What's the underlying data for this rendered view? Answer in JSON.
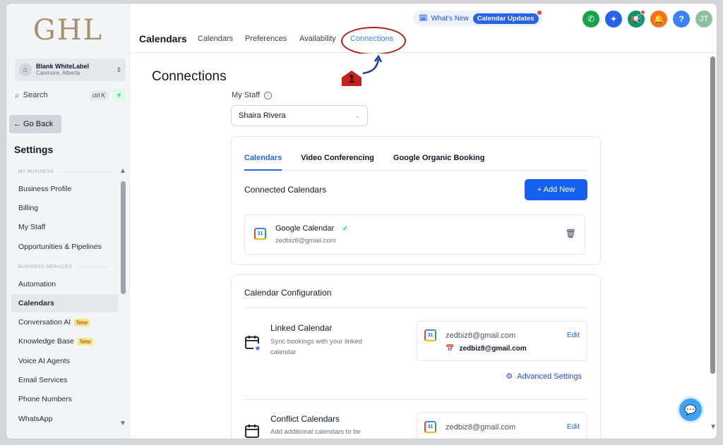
{
  "brand": {
    "logo": "GHL"
  },
  "account": {
    "name": "Blank WhiteLabel",
    "location": "Canmore, Alberta"
  },
  "search": {
    "label": "Search",
    "shortcut": "ctrl K"
  },
  "sidebar": {
    "go_back": "← Go Back",
    "settings_title": "Settings",
    "sections": {
      "my_business": "MY BUSINESS",
      "business_services": "BUSINESS SERVICES"
    },
    "items": [
      {
        "label": "Business Profile"
      },
      {
        "label": "Billing"
      },
      {
        "label": "My Staff"
      },
      {
        "label": "Opportunities & Pipelines"
      },
      {
        "label": "Automation"
      },
      {
        "label": "Calendars"
      },
      {
        "label": "Conversation AI",
        "badge": "New"
      },
      {
        "label": "Knowledge Base",
        "badge": "New"
      },
      {
        "label": "Voice AI Agents"
      },
      {
        "label": "Email Services"
      },
      {
        "label": "Phone Numbers"
      },
      {
        "label": "WhatsApp"
      }
    ]
  },
  "header": {
    "title": "Calendars",
    "tabs": [
      {
        "label": "Calendars"
      },
      {
        "label": "Preferences"
      },
      {
        "label": "Availability"
      },
      {
        "label": "Connections"
      }
    ],
    "whats_new": "What's New",
    "calendar_updates": "Calendar Updates",
    "avatar_initials": "JT",
    "help": "?"
  },
  "annotation": {
    "marker_number": "1"
  },
  "page": {
    "title": "Connections",
    "my_staff_label": "My Staff",
    "staff_selected": "Shaira Rivera"
  },
  "connected_card": {
    "tabs": [
      {
        "label": "Calendars"
      },
      {
        "label": "Video Conferencing"
      },
      {
        "label": "Google Organic Booking"
      }
    ],
    "section_title": "Connected Calendars",
    "add_new": "+ Add New",
    "calendar": {
      "name": "Google Calendar",
      "email": "zedbiz8@gmail.com",
      "icon_text": "31"
    }
  },
  "config_card": {
    "title": "Calendar Configuration",
    "linked": {
      "title": "Linked Calendar",
      "description": "Sync bookings with your linked calendar",
      "account_email": "zedbiz8@gmail.com",
      "calendar_email": "zedbiz8@gmail.com",
      "edit": "Edit"
    },
    "advanced_settings": "Advanced Settings",
    "conflict": {
      "title": "Conflict Calendars",
      "description": "Add additional calendars to be",
      "account_email": "zedbiz8@gmail.com",
      "edit": "Edit"
    }
  },
  "colors": {
    "primary": "#155eef",
    "accent_annotation": "#b91c1c",
    "logo": "#a8906c"
  }
}
